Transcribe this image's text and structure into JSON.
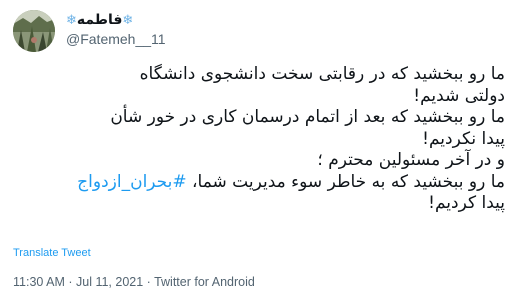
{
  "author": {
    "display_name": "فاطمه",
    "flake_left": "❄",
    "flake_right": "❄",
    "handle": "@Fatemeh__11"
  },
  "tweet": {
    "lines": [
      "ما رو ببخشید که در رقابتی سخت دانشجوی دانشگاه",
      "دولتی شدیم!",
      "ما رو ببخشید که بعد از اتمام درسمان کاری در خور شأن",
      "پیدا نکردیم!",
      "و در آخر مسئولین محترم ؛",
      "ما رو ببخشید که به خاطر سوء مدیریت شما،",
      "پیدا کردیم!"
    ],
    "hashtag": "#بحران_ازدواج"
  },
  "translate_label": "Translate Tweet",
  "meta": {
    "time": "11:30 AM",
    "separator1": " · ",
    "date": "Jul 11, 2021",
    "separator2": " · ",
    "source": "Twitter for Android"
  },
  "colors": {
    "link": "#1d9bf0",
    "secondary": "#536471",
    "text": "#0f1419"
  }
}
